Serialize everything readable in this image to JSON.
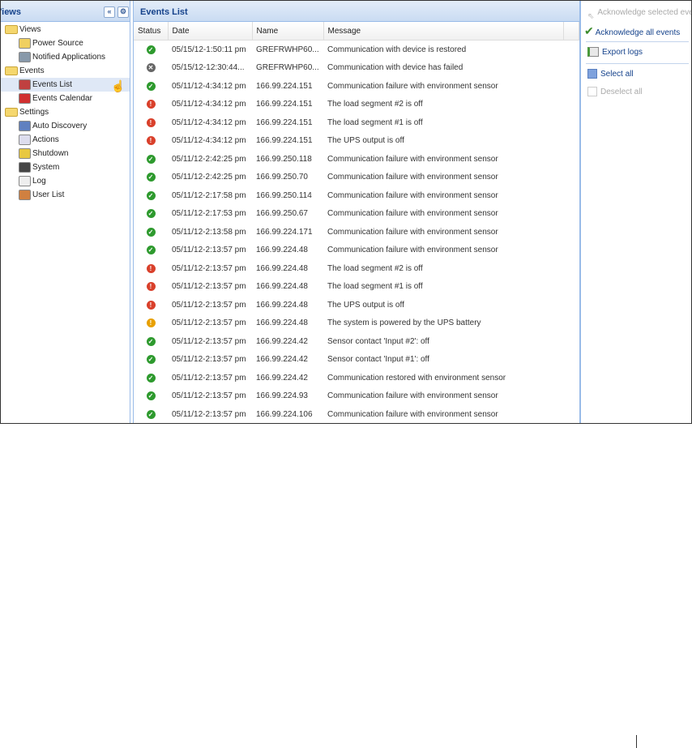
{
  "sidebar": {
    "title": "Views",
    "items": [
      {
        "label": "Views",
        "level": 0,
        "icon": "folder-icon"
      },
      {
        "label": "Power Source",
        "level": 1,
        "icon": "power-source-icon"
      },
      {
        "label": "Notified Applications",
        "level": 1,
        "icon": "notified-applications-icon"
      },
      {
        "label": "Events",
        "level": 0,
        "icon": "folder-icon"
      },
      {
        "label": "Events List",
        "level": 1,
        "icon": "events-list-icon",
        "selected": true
      },
      {
        "label": "Events Calendar",
        "level": 1,
        "icon": "events-calendar-icon"
      },
      {
        "label": "Settings",
        "level": 0,
        "icon": "folder-icon"
      },
      {
        "label": "Auto Discovery",
        "level": 1,
        "icon": "auto-discovery-icon"
      },
      {
        "label": "Actions",
        "level": 1,
        "icon": "actions-icon"
      },
      {
        "label": "Shutdown",
        "level": 1,
        "icon": "shutdown-icon"
      },
      {
        "label": "System",
        "level": 1,
        "icon": "system-icon"
      },
      {
        "label": "Log",
        "level": 1,
        "icon": "log-icon"
      },
      {
        "label": "User List",
        "level": 1,
        "icon": "user-list-icon"
      }
    ]
  },
  "main": {
    "title": "Events List",
    "columns": [
      "Status",
      "Date",
      "Name",
      "Message"
    ],
    "status_colors": {
      "ok": "#2e9a2e",
      "error": "#d9402b",
      "warning": "#e8a000",
      "unknown": "#666666"
    },
    "rows": [
      [
        "ok",
        "05/15/12-1:50:11 pm",
        "GREFRWHP60...",
        "Communication with device is restored"
      ],
      [
        "unknown",
        "05/15/12-12:30:44...",
        "GREFRWHP60...",
        "Communication with device has failed"
      ],
      [
        "ok",
        "05/11/12-4:34:12 pm",
        "166.99.224.151",
        "Communication failure with environment sensor"
      ],
      [
        "error",
        "05/11/12-4:34:12 pm",
        "166.99.224.151",
        "The load segment #2 is off"
      ],
      [
        "error",
        "05/11/12-4:34:12 pm",
        "166.99.224.151",
        "The load segment #1 is off"
      ],
      [
        "error",
        "05/11/12-4:34:12 pm",
        "166.99.224.151",
        "The UPS output is off"
      ],
      [
        "ok",
        "05/11/12-2:42:25 pm",
        "166.99.250.118",
        "Communication failure with environment sensor"
      ],
      [
        "ok",
        "05/11/12-2:42:25 pm",
        "166.99.250.70",
        "Communication failure with environment sensor"
      ],
      [
        "ok",
        "05/11/12-2:17:58 pm",
        "166.99.250.114",
        "Communication failure with environment sensor"
      ],
      [
        "ok",
        "05/11/12-2:17:53 pm",
        "166.99.250.67",
        "Communication failure with environment sensor"
      ],
      [
        "ok",
        "05/11/12-2:13:58 pm",
        "166.99.224.171",
        "Communication failure with environment sensor"
      ],
      [
        "ok",
        "05/11/12-2:13:57 pm",
        "166.99.224.48",
        "Communication failure with environment sensor"
      ],
      [
        "error",
        "05/11/12-2:13:57 pm",
        "166.99.224.48",
        "The load segment #2 is off"
      ],
      [
        "error",
        "05/11/12-2:13:57 pm",
        "166.99.224.48",
        "The load segment #1 is off"
      ],
      [
        "error",
        "05/11/12-2:13:57 pm",
        "166.99.224.48",
        "The UPS output is off"
      ],
      [
        "warning",
        "05/11/12-2:13:57 pm",
        "166.99.224.48",
        "The system is powered by the UPS battery"
      ],
      [
        "ok",
        "05/11/12-2:13:57 pm",
        "166.99.224.42",
        "Sensor contact 'Input #2': off"
      ],
      [
        "ok",
        "05/11/12-2:13:57 pm",
        "166.99.224.42",
        "Sensor contact 'Input #1': off"
      ],
      [
        "ok",
        "05/11/12-2:13:57 pm",
        "166.99.224.42",
        "Communication restored with environment sensor"
      ],
      [
        "ok",
        "05/11/12-2:13:57 pm",
        "166.99.224.93",
        "Communication failure with environment sensor"
      ],
      [
        "ok",
        "05/11/12-2:13:57 pm",
        "166.99.224.106",
        "Communication failure with environment sensor"
      ]
    ]
  },
  "actions": {
    "ack_selected": "Acknowledge selected events",
    "ack_all": "Acknowledge all events",
    "export": "Export logs",
    "select_all": "Select all",
    "deselect_all": "Deselect all"
  }
}
